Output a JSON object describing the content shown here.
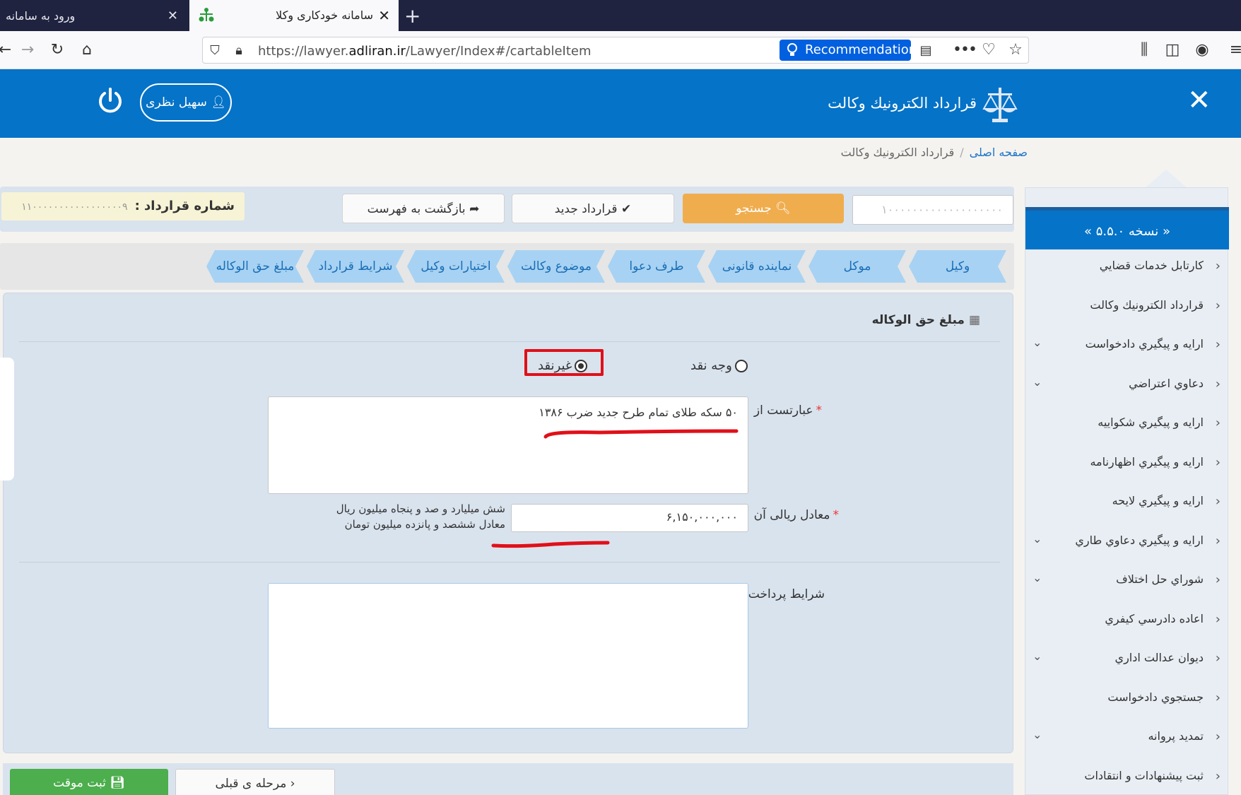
{
  "browser": {
    "inactive_tab_title": "ورود به سامانه",
    "active_tab_title": "سامانه خودکاری وکلا",
    "url_prefix": "https://lawyer.",
    "url_domain": "adliran.ir",
    "url_path": "/Lawyer/Index#/cartableItem",
    "recommendation_label": "Recommendation"
  },
  "header": {
    "app_title": "قرارداد الکترونيك وکالت",
    "user_name": "سهيل نظری"
  },
  "breadcrumb": {
    "home": "صفحه اصلی",
    "current": "قرارداد الکترونيك وکالت"
  },
  "sidebar": {
    "version": "« نسخه ۵.۵.۰ »",
    "items": [
      {
        "label": "کارتابل خدمات قضايي",
        "has_caret": false
      },
      {
        "label": "قرارداد الکترونيك وکالت",
        "has_caret": false
      },
      {
        "label": "ارايه و پيگيري دادخواست",
        "has_caret": true
      },
      {
        "label": "دعاوي اعتراضي",
        "has_caret": true
      },
      {
        "label": "ارايه و پيگيري شکواييه",
        "has_caret": false
      },
      {
        "label": "ارايه و پيگيري اظهارنامه",
        "has_caret": false
      },
      {
        "label": "ارايه و پيگيري لايحه",
        "has_caret": false
      },
      {
        "label": "ارايه و پيگيري دعاوي طاري",
        "has_caret": true
      },
      {
        "label": "شوراي حل اختلاف",
        "has_caret": true
      },
      {
        "label": "اعاده دادرسي كيفري",
        "has_caret": false
      },
      {
        "label": "ديوان عدالت اداري",
        "has_caret": true
      },
      {
        "label": "جستجوي دادخواست",
        "has_caret": false
      },
      {
        "label": "تمديد پروانه",
        "has_caret": true
      },
      {
        "label": "ثبت پيشنهادات و انتقادات",
        "has_caret": false
      }
    ]
  },
  "toolbar": {
    "contract_no_label": "شماره قرارداد :",
    "contract_no_value": "۱۱۰۰۰۰۰۰۰۰۰۰۰۰۰۰۰۰۰۹",
    "back_label": "بازگشت به فهرست",
    "new_label": "قرارداد جديد",
    "search_label": "جستجو",
    "search_value": "۱۰۰۰۰۰۰۰۰۰۰۰۰۰۰۰۰۰۰۰"
  },
  "steps": [
    "وکيل",
    "موکل",
    "نماينده قانونی",
    "طرف دعوا",
    "موضوع وکالت",
    "اختيارات وکيل",
    "شرايط قرارداد",
    "مبلغ حق الوکاله"
  ],
  "form": {
    "section_title": "مبلغ حق الوکاله",
    "radio_cash": "وجه نقد",
    "radio_noncash": "غيرنقد",
    "selected": "noncash",
    "consists_of_label": "عبارتست از",
    "consists_of_value": "۵۰ سکه طلای تمام طرح جديد ضرب ۱۳۸۶",
    "rial_equiv_label": "معادل ريالی آن",
    "rial_equiv_value": "۶,۱۵۰,۰۰۰,۰۰۰",
    "amount_words_rial": "شش ميليارد و صد و پنجاه ميليون ريال",
    "amount_words_toman": "معادل ششصد و پانزده ميليون تومان",
    "payment_terms_label": "شرايط پرداخت",
    "payment_terms_value": ""
  },
  "bottom": {
    "save_label": "ثبت موقت",
    "prev_label": "مرحله ی قبلی"
  },
  "colors": {
    "brand_blue": "#0473c8",
    "search_orange": "#f0ad4e",
    "save_green": "#4cae4c",
    "annotation_red": "#e0101a"
  }
}
